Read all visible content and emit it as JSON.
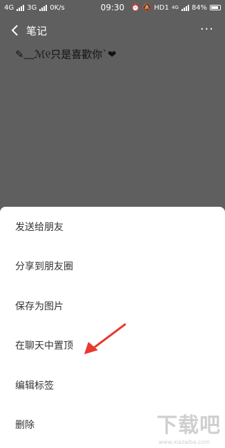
{
  "status_bar": {
    "left_text": "4G",
    "network2": "3G",
    "speed": "0K/s",
    "time": "09:30",
    "hd_label": "HD1",
    "lte_label": "4G",
    "battery": "84%"
  },
  "header": {
    "title": "笔记",
    "more_glyph": "···"
  },
  "note": {
    "text": "✎﹏ℳ୧只是喜歡你`❤"
  },
  "menu": {
    "items": [
      {
        "label": "发送给朋友"
      },
      {
        "label": "分享到朋友圈"
      },
      {
        "label": "保存为图片"
      },
      {
        "label": "在聊天中置顶"
      },
      {
        "label": "编辑标签"
      },
      {
        "label": "删除"
      }
    ]
  },
  "watermark": {
    "text": "下载吧",
    "url": "www.xiazaiba.com"
  },
  "colors": {
    "overlay": "#5f5f5f",
    "sheet": "#ffffff",
    "arrow": "#e8392f"
  }
}
